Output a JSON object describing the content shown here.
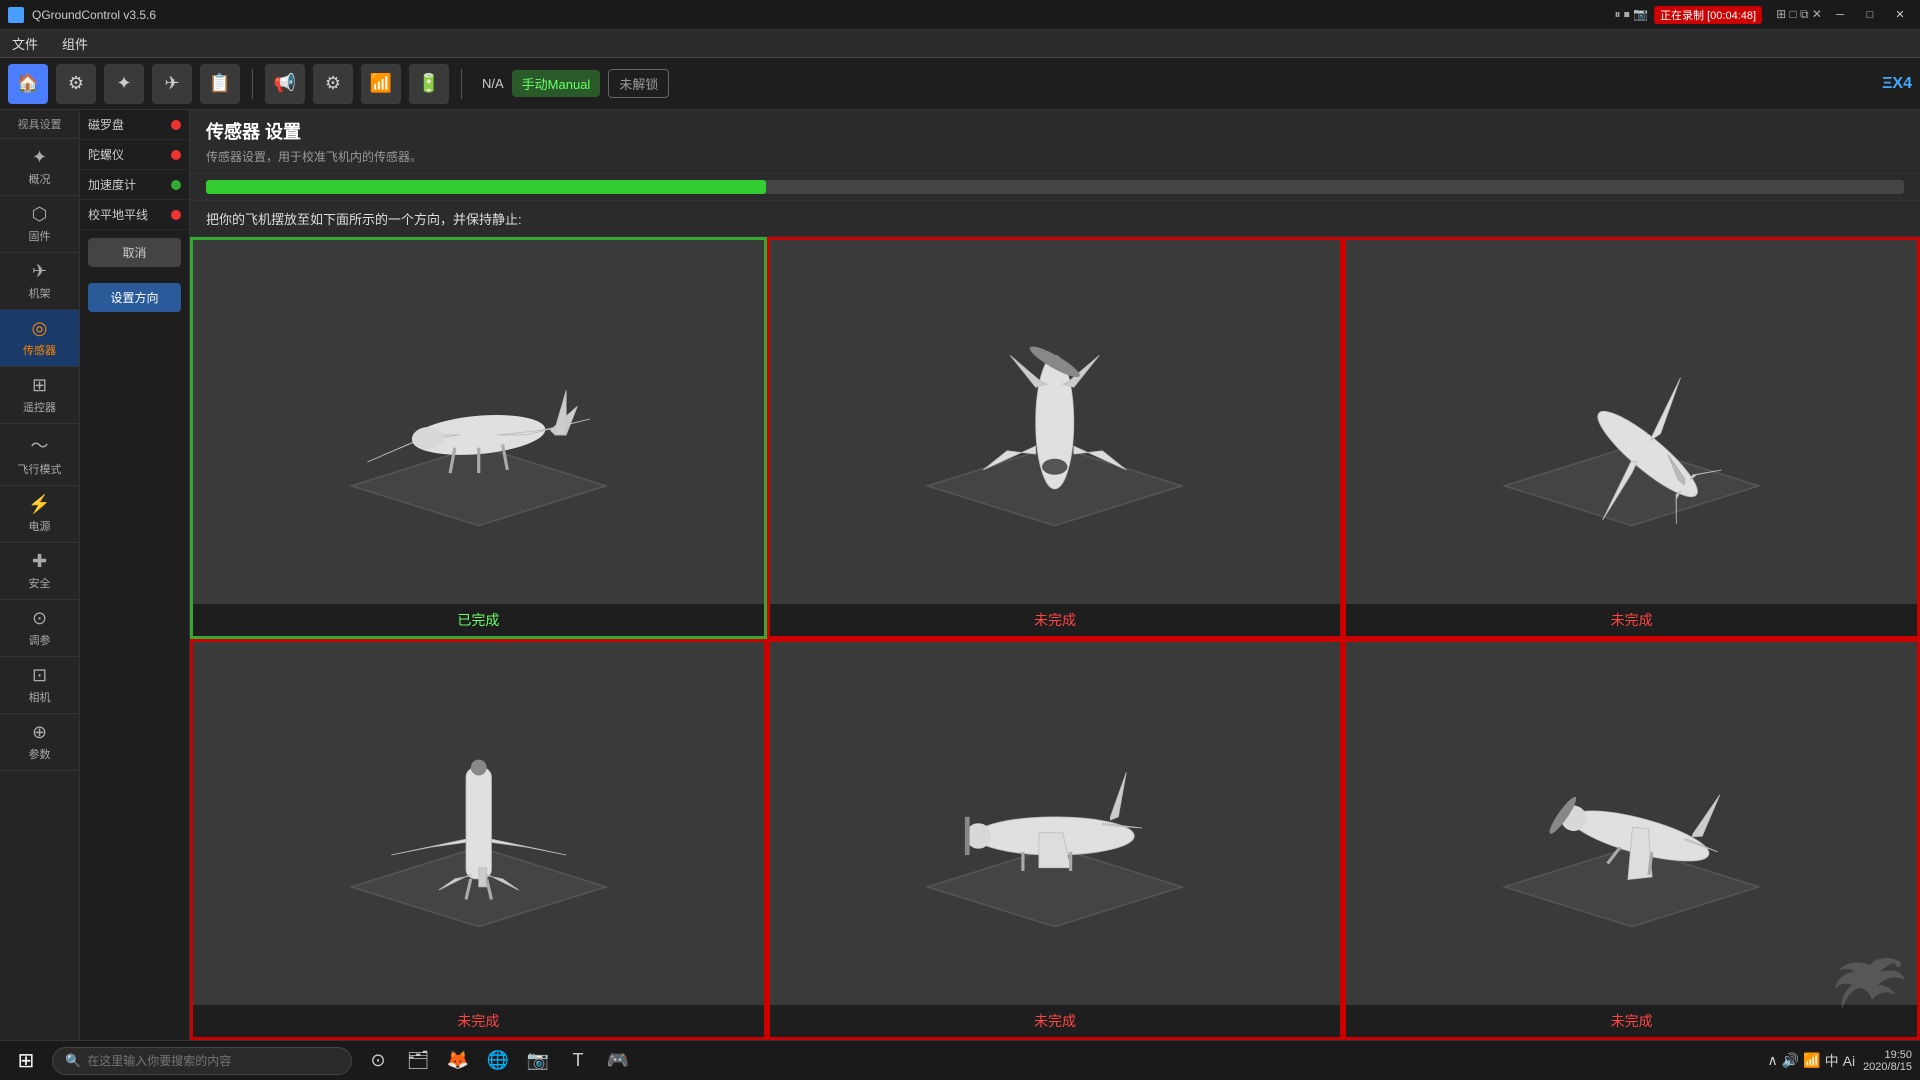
{
  "titlebar": {
    "title": "QGroundControl v3.5.6",
    "recording": "正在录制 [00:04:48]",
    "controls": [
      "minimize",
      "maximize",
      "close"
    ]
  },
  "menubar": {
    "items": [
      "文件",
      "组件"
    ]
  },
  "toolbar": {
    "mode_label": "手动Manual",
    "lock_label": "未解锁",
    "na_label": "N/A",
    "brand": "ΞΧ4"
  },
  "sidebar": {
    "header": "视具设置",
    "items": [
      {
        "id": "overview",
        "icon": "✦",
        "label": "概况"
      },
      {
        "id": "firmware",
        "icon": "⬡",
        "label": "固件"
      },
      {
        "id": "airframe",
        "icon": "✈",
        "label": "机架"
      },
      {
        "id": "sensors",
        "icon": "◎",
        "label": "传感器",
        "active": true
      },
      {
        "id": "remote",
        "icon": "⊞",
        "label": "遥控器"
      },
      {
        "id": "flight",
        "icon": "〜",
        "label": "飞行模式"
      },
      {
        "id": "power",
        "icon": "⚡",
        "label": "电源"
      },
      {
        "id": "safety",
        "icon": "✚",
        "label": "安全"
      },
      {
        "id": "tuning",
        "icon": "⊙",
        "label": "调参"
      },
      {
        "id": "camera",
        "icon": "⊡",
        "label": "相机"
      },
      {
        "id": "params",
        "icon": "⊕",
        "label": "参数"
      }
    ]
  },
  "sensor_panel": {
    "items": [
      {
        "label": "磁罗盘",
        "status": "red"
      },
      {
        "label": "陀螺仪",
        "status": "red"
      },
      {
        "label": "加速度计",
        "status": "green"
      },
      {
        "label": "校平地平线",
        "status": "red"
      }
    ],
    "cancel_btn": "取消",
    "set_direction_btn": "设置方向"
  },
  "content": {
    "title": "传感器 设置",
    "subtitle": "传感器设置，用于校准飞机内的传感器。",
    "progress": 33,
    "instructions": "把你的飞机摆放至如下面所示的一个方向，并保持静止:",
    "orientations": [
      {
        "id": "top-left",
        "status": "done",
        "label": "已完成"
      },
      {
        "id": "top-center",
        "status": "undone",
        "label": "未完成"
      },
      {
        "id": "top-right",
        "status": "undone",
        "label": "未完成"
      },
      {
        "id": "bottom-left",
        "status": "undone",
        "label": "未完成"
      },
      {
        "id": "bottom-center",
        "status": "undone",
        "label": "未完成"
      },
      {
        "id": "bottom-right",
        "status": "undone",
        "label": "未完成"
      }
    ]
  },
  "taskbar": {
    "search_placeholder": "在这里输入你要搜索的内容",
    "time": "19:50",
    "date": "2020/8/15",
    "tray_icons": [
      "^",
      "🔊",
      "🌐",
      "中"
    ],
    "app_icons": [
      "⊞",
      "🔍",
      "⟳",
      "📁",
      "🦊",
      "🔵",
      "📷",
      "T",
      "🎮"
    ]
  }
}
